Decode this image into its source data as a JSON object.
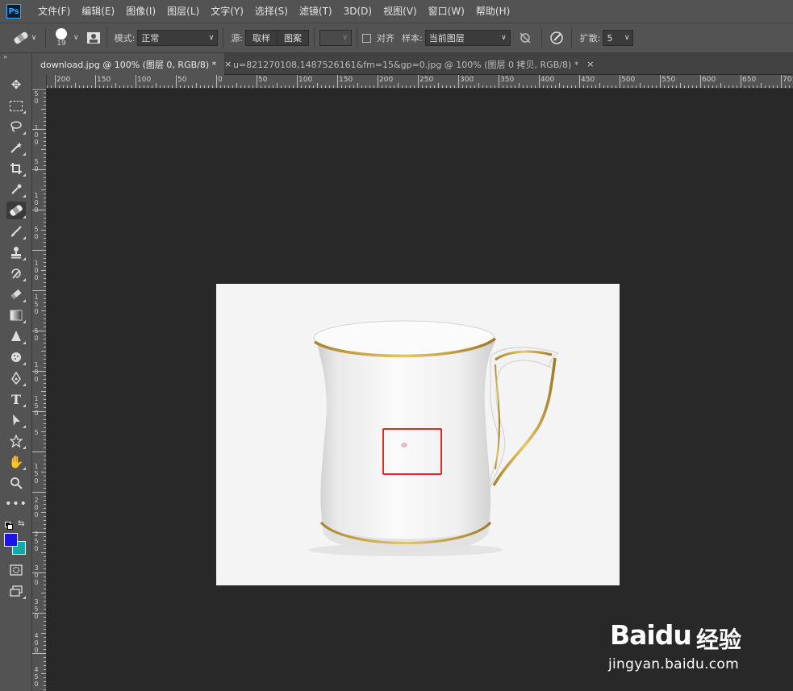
{
  "app": {
    "logo_text": "Ps"
  },
  "menu": [
    "文件(F)",
    "编辑(E)",
    "图像(I)",
    "图层(L)",
    "文字(Y)",
    "选择(S)",
    "滤镜(T)",
    "3D(D)",
    "视图(V)",
    "窗口(W)",
    "帮助(H)"
  ],
  "options": {
    "brush_size": "19",
    "mode_label": "模式:",
    "mode_value": "正常",
    "source_label": "源:",
    "source_sampled": "取样",
    "source_pattern": "图案",
    "aligned_label": "对齐",
    "sample_label": "样本:",
    "sample_value": "当前图层",
    "diffusion_label": "扩散:",
    "diffusion_value": "5"
  },
  "tabs": [
    {
      "label": "download.jpg @ 100% (图层 0, RGB/8) *",
      "close": "×"
    },
    {
      "label": "u=821270108,1487526161&fm=15&gp=0.jpg @ 100% (图层 0 拷贝, RGB/8) *",
      "close": "×"
    }
  ],
  "ruler": {
    "h_labels": [
      "200",
      "150",
      "100",
      "50",
      "0",
      "50",
      "100",
      "150",
      "200",
      "250",
      "300",
      "350",
      "400",
      "450",
      "500",
      "550",
      "600",
      "650",
      "70"
    ],
    "v_labels": [
      "5\n0",
      "1\n0\n0",
      "5\n0",
      "1\n0\n0",
      "5\n0",
      "1\n0\n0",
      "1\n5\n0",
      "5\n0",
      "1\n0\n0",
      "1\n5\n0",
      "5",
      "1\n5\n0",
      "2\n0\n0",
      "2\n5\n0",
      "3\n0\n0",
      "3\n5\n0",
      "4\n0\n0",
      "4\n5\n0"
    ]
  },
  "colors": {
    "foreground": "#1a14e8",
    "background": "#17a7a5",
    "selection": "#e02a2a"
  },
  "watermark": {
    "brand": "Baidu",
    "cn": "经验",
    "url": "jingyan.baidu.com"
  }
}
